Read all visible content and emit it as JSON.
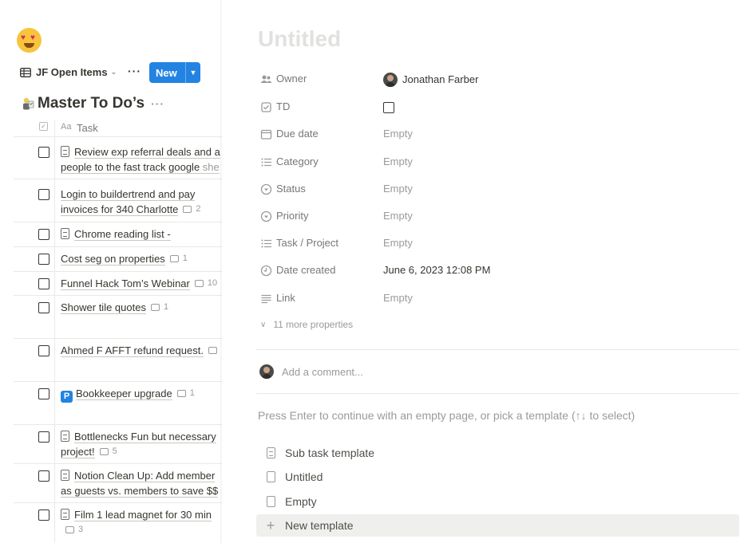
{
  "left": {
    "page_emoji": "smiling-face-with-heart-eyes",
    "view": {
      "tab_label": "JF Open Items",
      "more": "···",
      "new_label": "New"
    },
    "database": {
      "title": "Master To Do’s",
      "title_emoji": "person-with-checklist",
      "more": "···"
    },
    "column": {
      "type_hint": "Aa",
      "name": "Task"
    },
    "rows": [
      {
        "line1": "Review exp referral deals and a",
        "line2": "people to the fast track google ",
        "line2_tail": "she",
        "icon": "doc"
      },
      {
        "line1": "Login to buildertrend and pay",
        "line2": "invoices for 340 Charlotte",
        "comments": "2"
      },
      {
        "line1": "Chrome reading list -",
        "icon": "doc"
      },
      {
        "line1": "Cost seg on properties",
        "comments": "1"
      },
      {
        "line1": "Funnel Hack Tom’s Webinar",
        "comments": "10"
      },
      {
        "line1": "Shower tile quotes",
        "comments": "1"
      },
      {
        "line1": "Ahmed F AFFT refund request.",
        "comments": ""
      },
      {
        "line1": "Bookkeeper upgrade",
        "comments": "1",
        "icon": "P"
      },
      {
        "line1": "Bottlenecks Fun but necessary",
        "line2": "project!",
        "comments": "5",
        "icon": "doc"
      },
      {
        "line1": "Notion Clean Up: Add member",
        "line2": "as guests vs. members to save $$",
        "icon": "doc"
      },
      {
        "line1": "Film 1 lead magnet for 30 min",
        "comments": "3",
        "icon": "doc"
      }
    ]
  },
  "peek": {
    "title": "Untitled",
    "properties": [
      {
        "icon": "people-icon",
        "name": "Owner",
        "value": "Jonathan Farber"
      },
      {
        "icon": "checkbox-icon",
        "name": "TD",
        "value": ""
      },
      {
        "icon": "calendar-icon",
        "name": "Due date",
        "value": "Empty"
      },
      {
        "icon": "list-icon",
        "name": "Category",
        "value": "Empty"
      },
      {
        "icon": "status-icon",
        "name": "Status",
        "value": "Empty"
      },
      {
        "icon": "select-icon",
        "name": "Priority",
        "value": "Empty"
      },
      {
        "icon": "list-icon",
        "name": "Task / Project",
        "value": "Empty"
      },
      {
        "icon": "clock-icon",
        "name": "Date created",
        "value": "June 6, 2023 12:08 PM"
      },
      {
        "icon": "link-icon",
        "name": "Link",
        "value": "Empty"
      }
    ],
    "more_properties": "11 more properties",
    "comment_placeholder": "Add a comment...",
    "hint": "Press Enter to continue with an empty page, or pick a template (↑↓ to select)",
    "templates": [
      {
        "label": "Sub task template"
      },
      {
        "label": "Untitled"
      },
      {
        "label": "Empty"
      },
      {
        "label": "New template"
      }
    ]
  }
}
